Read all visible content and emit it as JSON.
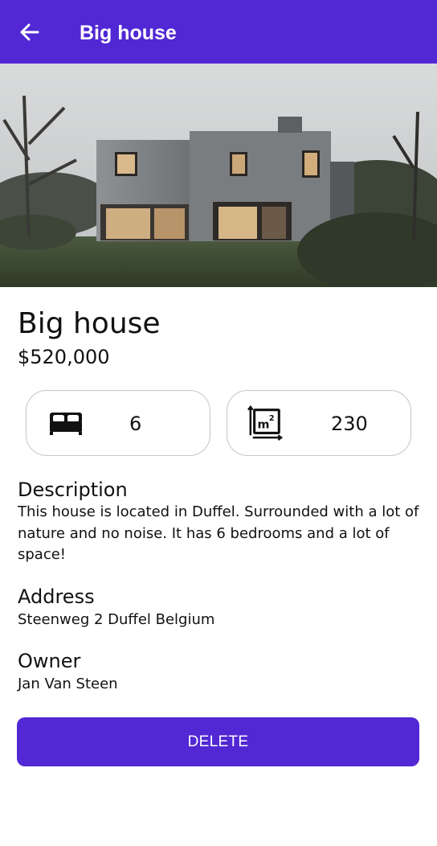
{
  "appbar": {
    "title": "Big house",
    "back_icon": "arrow-left-icon",
    "background": "#5128d4"
  },
  "hero": {
    "image": "house-photo"
  },
  "listing": {
    "title": "Big house",
    "price": "$520,000"
  },
  "stats": {
    "bedrooms": {
      "icon": "bed-icon",
      "value": "6"
    },
    "area": {
      "icon": "square-meter-icon",
      "value": "230"
    }
  },
  "description": {
    "heading": "Description",
    "text": "This house is located in Duffel. Surrounded with a lot of nature and no noise. It has 6 bedrooms and a lot of space!"
  },
  "address": {
    "heading": "Address",
    "text": "Steenweg 2 Duffel Belgium"
  },
  "owner": {
    "heading": "Owner",
    "text": "Jan Van Steen"
  },
  "actions": {
    "delete_label": "DELETE",
    "accent": "#5128d4"
  }
}
